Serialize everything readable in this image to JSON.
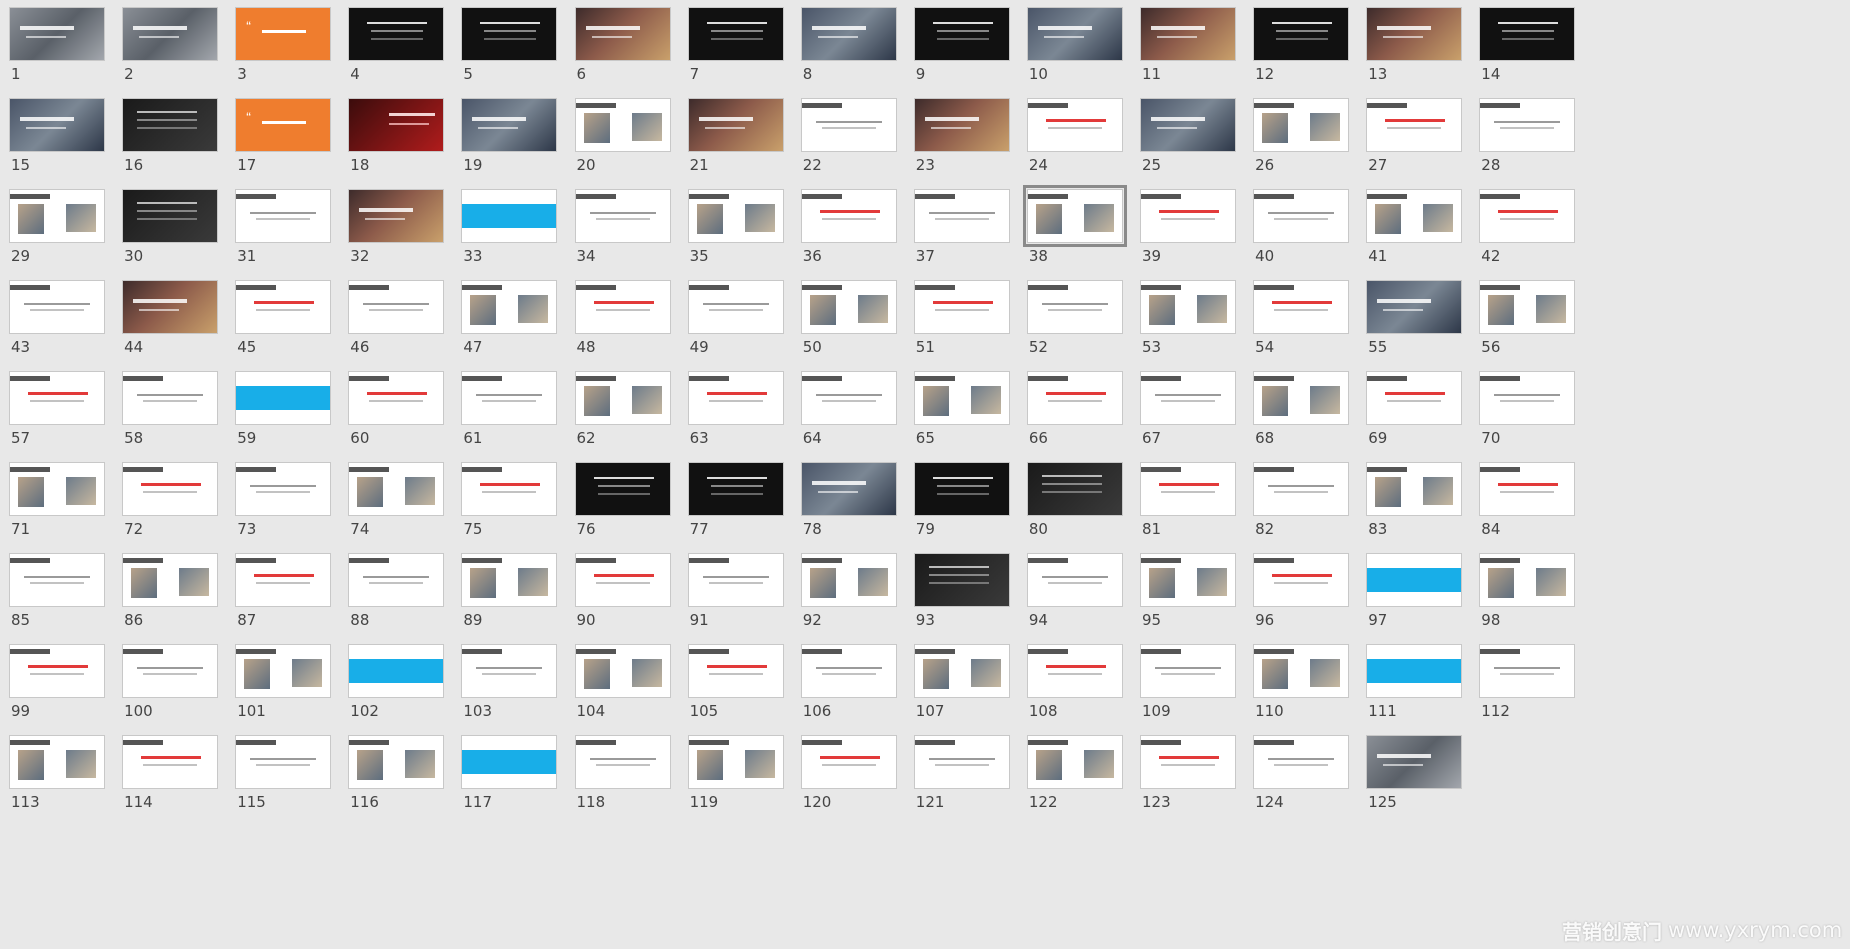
{
  "app": "slide-sorter",
  "selected_slide": 38,
  "slides": [
    {
      "n": "1",
      "s": "photo"
    },
    {
      "n": "2",
      "s": "photo"
    },
    {
      "n": "3",
      "s": "orange"
    },
    {
      "n": "4",
      "s": "black"
    },
    {
      "n": "5",
      "s": "black"
    },
    {
      "n": "6",
      "s": "photo2"
    },
    {
      "n": "7",
      "s": "black"
    },
    {
      "n": "8",
      "s": "photo3"
    },
    {
      "n": "9",
      "s": "black"
    },
    {
      "n": "10",
      "s": "photo3"
    },
    {
      "n": "11",
      "s": "photo2"
    },
    {
      "n": "12",
      "s": "black"
    },
    {
      "n": "13",
      "s": "photo2"
    },
    {
      "n": "14",
      "s": "black"
    },
    {
      "n": "15",
      "s": "photo3"
    },
    {
      "n": "16",
      "s": "dark"
    },
    {
      "n": "17",
      "s": "orange"
    },
    {
      "n": "18",
      "s": "red"
    },
    {
      "n": "19",
      "s": "photo3"
    },
    {
      "n": "20",
      "s": "white"
    },
    {
      "n": "21",
      "s": "photo2"
    },
    {
      "n": "22",
      "s": "white"
    },
    {
      "n": "23",
      "s": "photo2"
    },
    {
      "n": "24",
      "s": "white"
    },
    {
      "n": "25",
      "s": "photo3"
    },
    {
      "n": "26",
      "s": "white"
    },
    {
      "n": "27",
      "s": "white"
    },
    {
      "n": "28",
      "s": "white"
    },
    {
      "n": "29",
      "s": "white"
    },
    {
      "n": "30",
      "s": "dark"
    },
    {
      "n": "31",
      "s": "white"
    },
    {
      "n": "32",
      "s": "photo2"
    },
    {
      "n": "33",
      "s": "blue"
    },
    {
      "n": "34",
      "s": "white"
    },
    {
      "n": "35",
      "s": "white"
    },
    {
      "n": "36",
      "s": "white"
    },
    {
      "n": "37",
      "s": "white"
    },
    {
      "n": "38",
      "s": "white"
    },
    {
      "n": "39",
      "s": "white"
    },
    {
      "n": "40",
      "s": "white"
    },
    {
      "n": "41",
      "s": "white"
    },
    {
      "n": "42",
      "s": "white"
    },
    {
      "n": "43",
      "s": "white"
    },
    {
      "n": "44",
      "s": "photo2"
    },
    {
      "n": "45",
      "s": "white"
    },
    {
      "n": "46",
      "s": "white"
    },
    {
      "n": "47",
      "s": "white"
    },
    {
      "n": "48",
      "s": "white"
    },
    {
      "n": "49",
      "s": "white"
    },
    {
      "n": "50",
      "s": "white"
    },
    {
      "n": "51",
      "s": "white"
    },
    {
      "n": "52",
      "s": "white"
    },
    {
      "n": "53",
      "s": "white"
    },
    {
      "n": "54",
      "s": "white"
    },
    {
      "n": "55",
      "s": "photo3"
    },
    {
      "n": "56",
      "s": "white"
    },
    {
      "n": "57",
      "s": "white"
    },
    {
      "n": "58",
      "s": "white"
    },
    {
      "n": "59",
      "s": "blue"
    },
    {
      "n": "60",
      "s": "white"
    },
    {
      "n": "61",
      "s": "white"
    },
    {
      "n": "62",
      "s": "white"
    },
    {
      "n": "63",
      "s": "white"
    },
    {
      "n": "64",
      "s": "white"
    },
    {
      "n": "65",
      "s": "white"
    },
    {
      "n": "66",
      "s": "white"
    },
    {
      "n": "67",
      "s": "white"
    },
    {
      "n": "68",
      "s": "white"
    },
    {
      "n": "69",
      "s": "white"
    },
    {
      "n": "70",
      "s": "white"
    },
    {
      "n": "71",
      "s": "white"
    },
    {
      "n": "72",
      "s": "white"
    },
    {
      "n": "73",
      "s": "white"
    },
    {
      "n": "74",
      "s": "white"
    },
    {
      "n": "75",
      "s": "white"
    },
    {
      "n": "76",
      "s": "black"
    },
    {
      "n": "77",
      "s": "black"
    },
    {
      "n": "78",
      "s": "photo3"
    },
    {
      "n": "79",
      "s": "black"
    },
    {
      "n": "80",
      "s": "dark"
    },
    {
      "n": "81",
      "s": "white"
    },
    {
      "n": "82",
      "s": "white"
    },
    {
      "n": "83",
      "s": "white"
    },
    {
      "n": "84",
      "s": "white"
    },
    {
      "n": "85",
      "s": "white"
    },
    {
      "n": "86",
      "s": "white"
    },
    {
      "n": "87",
      "s": "white"
    },
    {
      "n": "88",
      "s": "white"
    },
    {
      "n": "89",
      "s": "white"
    },
    {
      "n": "90",
      "s": "white"
    },
    {
      "n": "91",
      "s": "white"
    },
    {
      "n": "92",
      "s": "white"
    },
    {
      "n": "93",
      "s": "dark"
    },
    {
      "n": "94",
      "s": "white"
    },
    {
      "n": "95",
      "s": "white"
    },
    {
      "n": "96",
      "s": "white"
    },
    {
      "n": "97",
      "s": "blue"
    },
    {
      "n": "98",
      "s": "white"
    },
    {
      "n": "99",
      "s": "white"
    },
    {
      "n": "100",
      "s": "white"
    },
    {
      "n": "101",
      "s": "white"
    },
    {
      "n": "102",
      "s": "blue"
    },
    {
      "n": "103",
      "s": "white"
    },
    {
      "n": "104",
      "s": "white"
    },
    {
      "n": "105",
      "s": "white"
    },
    {
      "n": "106",
      "s": "white"
    },
    {
      "n": "107",
      "s": "white"
    },
    {
      "n": "108",
      "s": "white"
    },
    {
      "n": "109",
      "s": "white"
    },
    {
      "n": "110",
      "s": "white"
    },
    {
      "n": "111",
      "s": "blue"
    },
    {
      "n": "112",
      "s": "white"
    },
    {
      "n": "113",
      "s": "white"
    },
    {
      "n": "114",
      "s": "white"
    },
    {
      "n": "115",
      "s": "white"
    },
    {
      "n": "116",
      "s": "white"
    },
    {
      "n": "117",
      "s": "blue"
    },
    {
      "n": "118",
      "s": "white"
    },
    {
      "n": "119",
      "s": "white"
    },
    {
      "n": "120",
      "s": "white"
    },
    {
      "n": "121",
      "s": "white"
    },
    {
      "n": "122",
      "s": "white"
    },
    {
      "n": "123",
      "s": "white"
    },
    {
      "n": "124",
      "s": "white"
    },
    {
      "n": "125",
      "s": "photo"
    }
  ],
  "watermark": {
    "brand": "营销创意门",
    "url": "www.yxrym.com"
  },
  "colors": {
    "background": "#e8e8e8",
    "accent_blue": "#18aee8",
    "accent_orange": "#ef7d2e",
    "selection": "#8a8a8a"
  }
}
